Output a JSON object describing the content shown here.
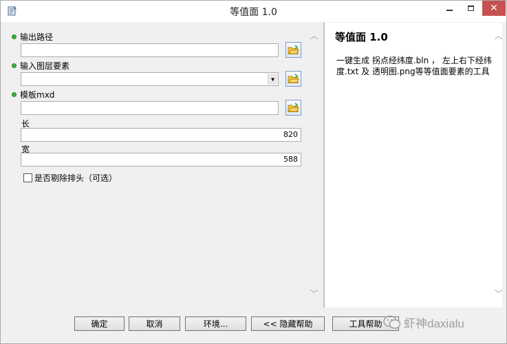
{
  "window": {
    "title": "等值面 1.0"
  },
  "params": {
    "output_path": {
      "label": "输出路径",
      "value": ""
    },
    "input_layer": {
      "label": "输入图层要素",
      "value": ""
    },
    "template_mxd": {
      "label": "模板mxd",
      "value": ""
    },
    "length": {
      "label": "长",
      "value": "820"
    },
    "width": {
      "label": "宽",
      "value": "588"
    },
    "remove_header": {
      "label": "是否剔除排头（可选）",
      "checked": false
    }
  },
  "help": {
    "title": "等值面  1.0",
    "body": "一键生成 拐点经纬度.bln ，  左上右下经纬度.txt 及 透明图.png等等值面要素的工具"
  },
  "buttons": {
    "ok": "确定",
    "cancel": "取消",
    "environments": "环境...",
    "hide_help": "<< 隐藏帮助",
    "tool_help": "工具帮助"
  },
  "watermark": "虾神daxialu"
}
